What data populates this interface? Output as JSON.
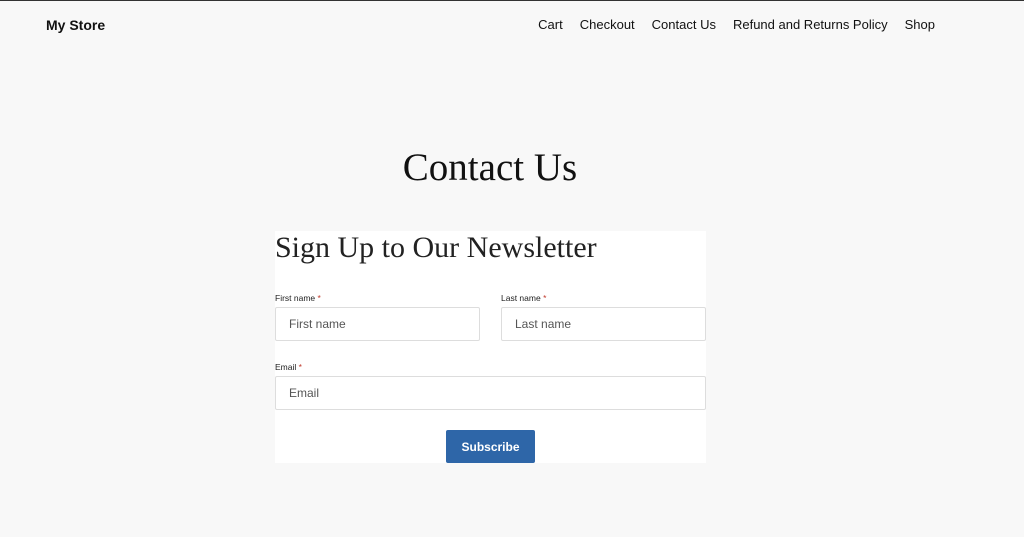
{
  "header": {
    "site_title": "My Store",
    "nav": [
      {
        "label": "Cart"
      },
      {
        "label": "Checkout"
      },
      {
        "label": "Contact Us"
      },
      {
        "label": "Refund and Returns Policy"
      },
      {
        "label": "Shop"
      }
    ]
  },
  "page": {
    "title": "Contact Us"
  },
  "newsletter": {
    "heading": "Sign Up to Our Newsletter",
    "required_marker": "*",
    "first_name": {
      "label": "First name",
      "placeholder": "First name",
      "value": ""
    },
    "last_name": {
      "label": "Last name",
      "placeholder": "Last name",
      "value": ""
    },
    "email": {
      "label": "Email",
      "placeholder": "Email",
      "value": ""
    },
    "submit_label": "Subscribe"
  },
  "colors": {
    "accent": "#2e66a8",
    "background": "#f8f8f8",
    "required": "#c0392b"
  }
}
